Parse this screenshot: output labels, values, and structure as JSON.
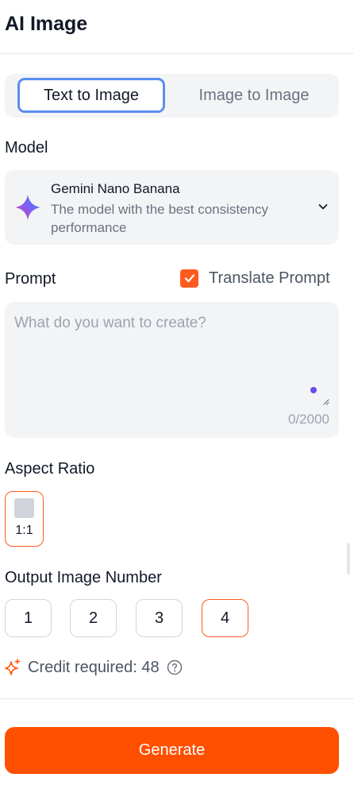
{
  "header": {
    "title": "AI Image"
  },
  "tabs": [
    {
      "label": "Text to Image",
      "active": true
    },
    {
      "label": "Image to Image",
      "active": false
    }
  ],
  "model": {
    "section_label": "Model",
    "name": "Gemini Nano Banana",
    "description": "The model with the best consistency performance",
    "icon": "gemini-sparkle-icon"
  },
  "prompt": {
    "section_label": "Prompt",
    "translate_label": "Translate Prompt",
    "translate_checked": true,
    "placeholder": "What do you want to create?",
    "value": "",
    "counter": "0/2000"
  },
  "aspect_ratio": {
    "section_label": "Aspect Ratio",
    "options": [
      {
        "label": "1:1",
        "selected": true
      }
    ]
  },
  "output": {
    "section_label": "Output Image Number",
    "options": [
      "1",
      "2",
      "3",
      "4"
    ],
    "selected": "4"
  },
  "credit": {
    "label": "Credit required: 48",
    "icon": "sparkle-icon"
  },
  "generate_label": "Generate",
  "colors": {
    "accent": "#ff4f00",
    "tab_focus": "#5b8def",
    "surface": "#f3f4f6"
  }
}
